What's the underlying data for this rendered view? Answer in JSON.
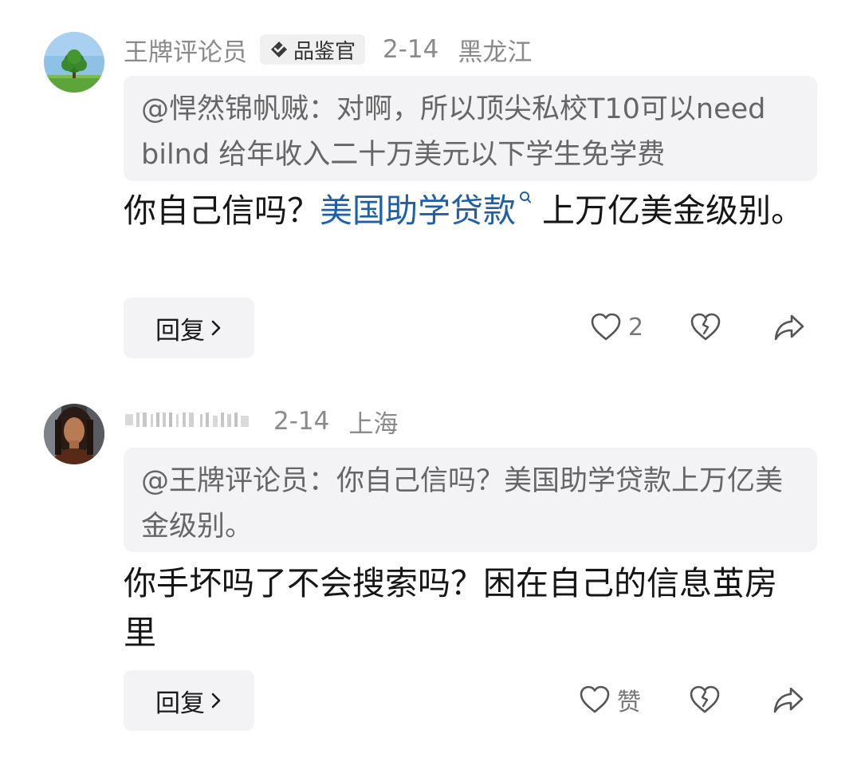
{
  "comments": [
    {
      "username": "王牌评论员",
      "badge": "品鉴官",
      "date": "2-14",
      "location": "黑龙江",
      "quote": "@悍然锦帆贼：对啊，所以顶尖私校T10可以need bilnd 给年收入二十万美元以下学生免学费",
      "body_before": "你自己信吗？",
      "body_link": "美国助学贷款",
      "body_after": "上万亿美金级别。",
      "reply_label": "回复",
      "like_count": "2"
    },
    {
      "username": "",
      "date": "2-14",
      "location": "上海",
      "quote": "@王牌评论员：你自己信吗？美国助学贷款上万亿美金级别。",
      "body": "你手坏吗了不会搜索吗？困在自己的信息茧房里",
      "reply_label": "回复",
      "like_label": "赞"
    }
  ],
  "colors": {
    "link": "#1d5fa8",
    "meta": "#8a8a8a",
    "quote_bg": "#f3f3f5"
  },
  "icons": [
    "heart-icon",
    "broken-heart-icon",
    "share-icon",
    "chevron-right-icon",
    "badge-diamond-icon",
    "search-mini-icon"
  ]
}
